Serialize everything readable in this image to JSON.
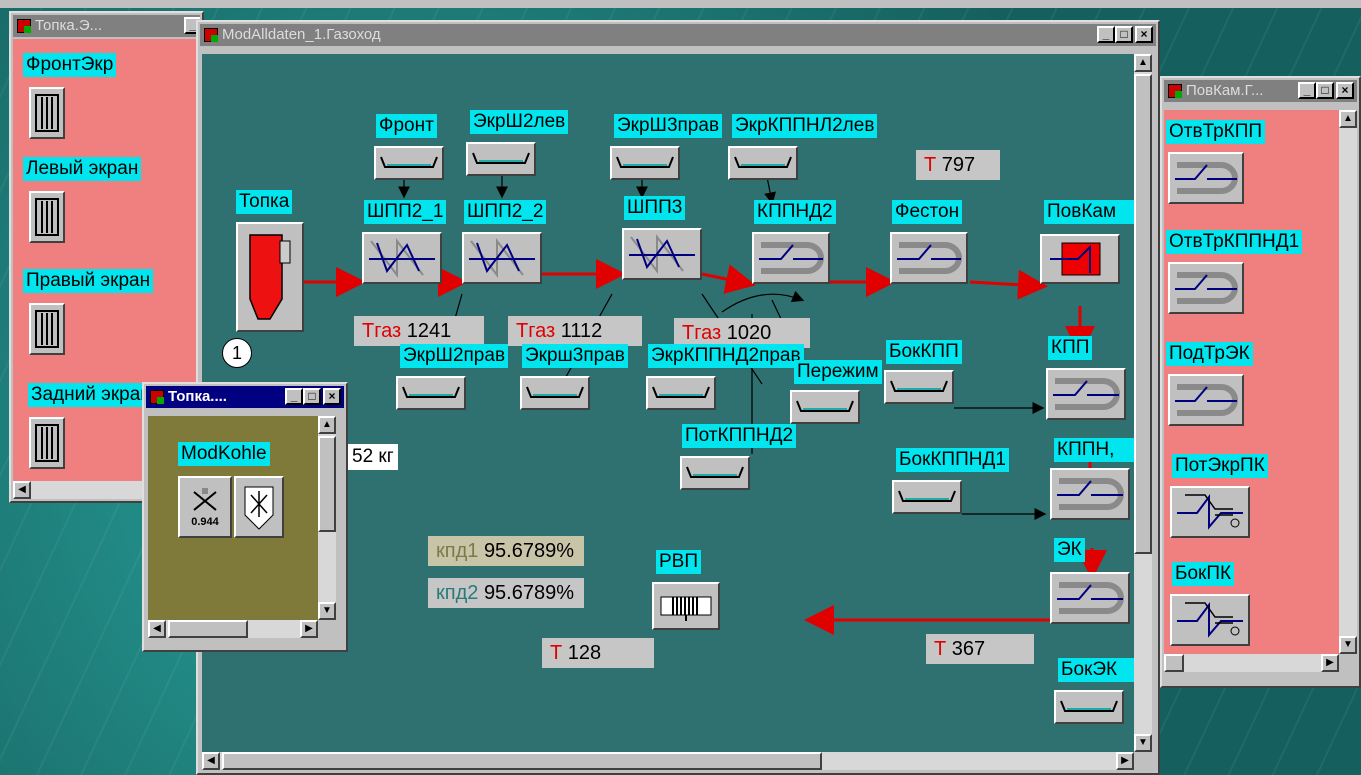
{
  "window_topka_e": {
    "title": "Топка.Э...",
    "labels": [
      "ФронтЭкр",
      "Левый экран",
      "Правый экран",
      "Задний экран"
    ]
  },
  "window_main": {
    "title": "ModAlldaten_1.Газоход",
    "labels": {
      "front": "Фронт",
      "ekrsh2lev": "ЭкрШ2лев",
      "ekrsh3prav": "ЭкрШ3прав",
      "ekrkppnl2lev": "ЭкрКППНЛ2лев",
      "topka": "Топка",
      "shpp2_1": "ШПП2_1",
      "shpp2_2": "ШПП2_2",
      "shpp3": "ШПП3",
      "kppnd2": "КППНД2",
      "feston": "Фестон",
      "povkam": "ПовКам",
      "ekrsh2prav": "ЭкрШ2прав",
      "ekrsh3prav_low": "Экрш3прав",
      "ekrkppnd2prav": "ЭкрКППНД2прав",
      "perezhim": "Пережим",
      "bokkpp": "БокКПП",
      "kpp": "КПП",
      "potkppnd2": "ПотКППНД2",
      "bokkppnd1": "БокКППНД1",
      "kppn": "КППН,",
      "ek": "ЭК",
      "rvp": "РВП",
      "bokek": "БокЭК"
    },
    "readouts": [
      {
        "key": "Т",
        "value": "797"
      },
      {
        "key": "Тгаз",
        "value": "1241"
      },
      {
        "key": "Тгаз",
        "value": "1112"
      },
      {
        "key": "Тгаз",
        "value": "1020"
      },
      {
        "key": "Т",
        "value": "128"
      },
      {
        "key": "Т",
        "value": "367"
      }
    ],
    "kpd1_label": "кпд1",
    "kpd1_value": "95.6789%",
    "kpd2_label": "кпд2",
    "kpd2_value": "95.6789%",
    "partial_text": "52 кг",
    "circle_number": "1"
  },
  "window_topka_small": {
    "title": "Топка....",
    "label": "ModKohle",
    "value": "0.944"
  },
  "window_povkam": {
    "title": "ПовКам.Г...",
    "labels": [
      "ОтвТрКПП",
      "ОтвТрКППНД1",
      "ПодТрЭК",
      "ПотЭкрПК",
      "БокПК"
    ]
  },
  "colors": {
    "label_bg": "#00e5ee",
    "main_bg": "#2f7070",
    "pink_bg": "#f08080",
    "olive_bg": "#7f7a3a",
    "flow_red": "#e00000"
  }
}
